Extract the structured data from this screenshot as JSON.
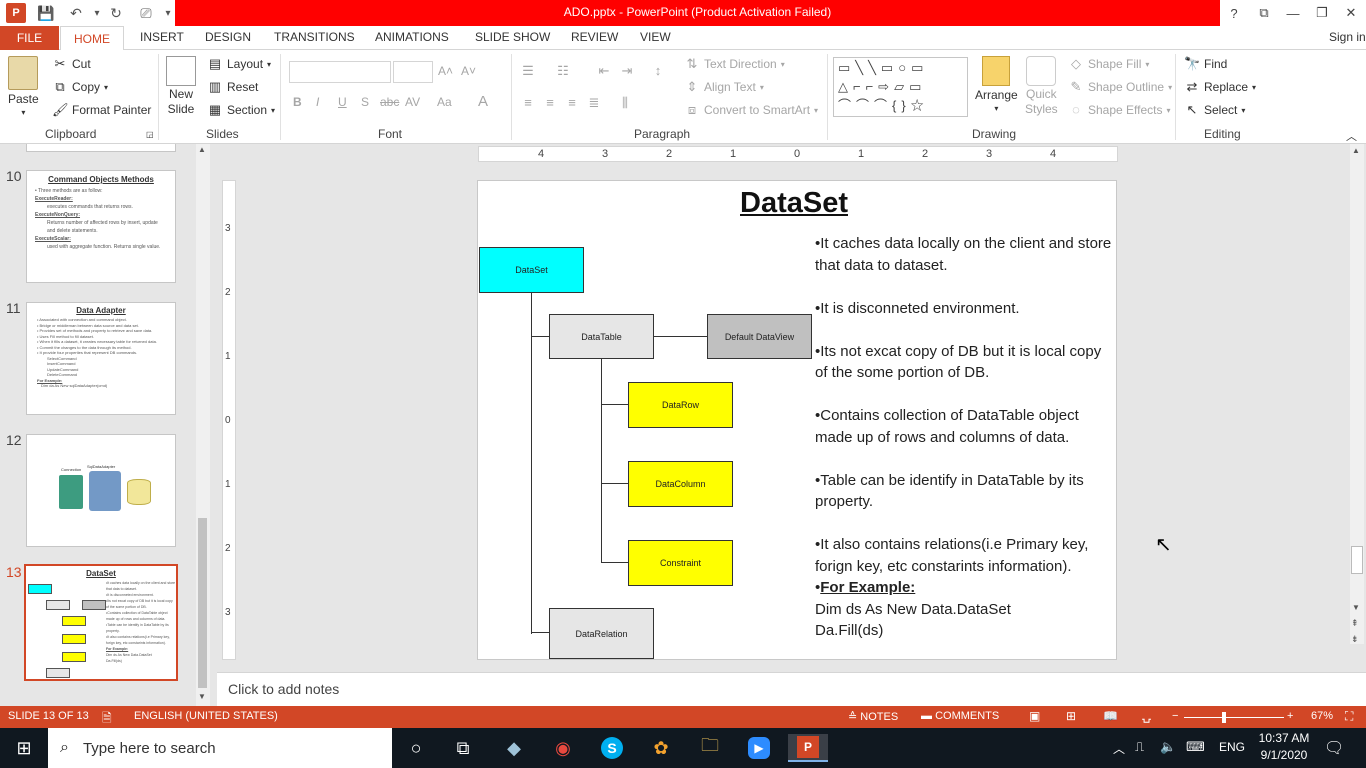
{
  "window": {
    "title": "ADO.pptx - PowerPoint (Product Activation Failed)",
    "controls": [
      "?",
      "⧉",
      "—",
      "❐",
      "✕"
    ],
    "sign_in": "Sign in"
  },
  "tabs": [
    "FILE",
    "HOME",
    "INSERT",
    "DESIGN",
    "TRANSITIONS",
    "ANIMATIONS",
    "SLIDE SHOW",
    "REVIEW",
    "VIEW"
  ],
  "ribbon": {
    "clipboard": {
      "paste": "Paste",
      "cut": "Cut",
      "copy": "Copy",
      "format_painter": "Format Painter",
      "label": "Clipboard"
    },
    "slides": {
      "new_slide": "New",
      "new_slide_2": "Slide",
      "layout": "Layout",
      "reset": "Reset",
      "section": "Section",
      "label": "Slides"
    },
    "font": {
      "label": "Font",
      "bold": "B",
      "italic": "I",
      "underline": "U",
      "strike": "S",
      "abc": "abc",
      "av": "AV",
      "aa": "Aa",
      "a": "A"
    },
    "paragraph": {
      "text_direction": "Text Direction",
      "align_text": "Align Text",
      "convert_smartart": "Convert to SmartArt",
      "label": "Paragraph"
    },
    "drawing": {
      "arrange": "Arrange",
      "quick": "Quick",
      "styles": "Styles",
      "shape_fill": "Shape Fill",
      "shape_outline": "Shape Outline",
      "shape_effects": "Shape Effects",
      "label": "Drawing"
    },
    "editing": {
      "find": "Find",
      "replace": "Replace",
      "select": "Select",
      "label": "Editing"
    }
  },
  "ruler": {
    "h_ticks": [
      "4",
      "3",
      "2",
      "1",
      "0",
      "1",
      "2",
      "3",
      "4"
    ],
    "v_ticks": [
      "3",
      "2",
      "1",
      "0",
      "1",
      "2",
      "3"
    ]
  },
  "thumbnails": [
    {
      "num": "10",
      "title": "Command Objects Methods",
      "lines": [
        "• Three methods are as follow:",
        "ExecuteReader:",
        "executes commands that returns rows.",
        "ExecuteNonQuery:",
        "Returns number of affected rows by insert, update and delete statements.",
        "ExecuteScalar:",
        "used with aggregate function. Returns single value."
      ]
    },
    {
      "num": "11",
      "title": "Data Adapter",
      "lines": [
        "• Associated with connection and command object.",
        "• Bridge or middleman between data source and data set.",
        "• Provides set of methods and property to retrieve and save data.",
        "• Uses Fill method to fill dataset.",
        "• When it fills a dataset, it creates necessary table for returned data.",
        "• Commit the changes to the data through its method.",
        "• It provide four properties that represent DB commands.",
        "SelectCommand",
        "InsertCommand",
        "UpdateCommand",
        "DeleteCommand",
        "For Example:",
        "Dim da As New sqlDataAdapter(cmd)"
      ]
    },
    {
      "num": "12",
      "labels": [
        "Connection",
        "SqlDataAdapter"
      ]
    },
    {
      "num": "13",
      "title": "DataSet"
    }
  ],
  "slide": {
    "title": "DataSet",
    "diagram": {
      "dataset": "DataSet",
      "datatable": "DataTable",
      "default_dataview": "Default DataView",
      "datarow": "DataRow",
      "datacolumn": "DataColumn",
      "constraint": "Constraint",
      "datarelation": "DataRelation"
    },
    "bullets": [
      "•It caches data locally on the client and store that data to dataset.",
      "•It is disconneted environment.",
      "•Its not excat copy of DB but it is local copy of the some portion of DB.",
      "•Contains collection of DataTable object made up of rows and columns of data.",
      "•Table can be identify in DataTable by its property.",
      "•It also contains relations(i.e Primary key, forign key, etc constarints information)."
    ],
    "example_bullet": "•",
    "example_label": "For Example:",
    "code_lines": [
      "Dim ds As New Data.DataSet",
      "Da.Fill(ds)"
    ]
  },
  "notes_placeholder": "Click to add notes",
  "status": {
    "slide_info": "SLIDE 13 OF 13",
    "language": "ENGLISH (UNITED STATES)",
    "notes": "NOTES",
    "comments": "COMMENTS",
    "zoom": "67%",
    "zoom_fraction": 0.4
  },
  "taskbar": {
    "search_placeholder": "Type here to search",
    "lang": "ENG",
    "time": "10:37 AM",
    "date": "9/1/2020"
  },
  "colors": {
    "accent": "#d24726",
    "title_red": "#ff0000",
    "dataset_box": "#00ffff",
    "yellow_box": "#ffff00",
    "gray_box": "#e6e6e6",
    "dark_gray_box": "#c0c0c0"
  }
}
